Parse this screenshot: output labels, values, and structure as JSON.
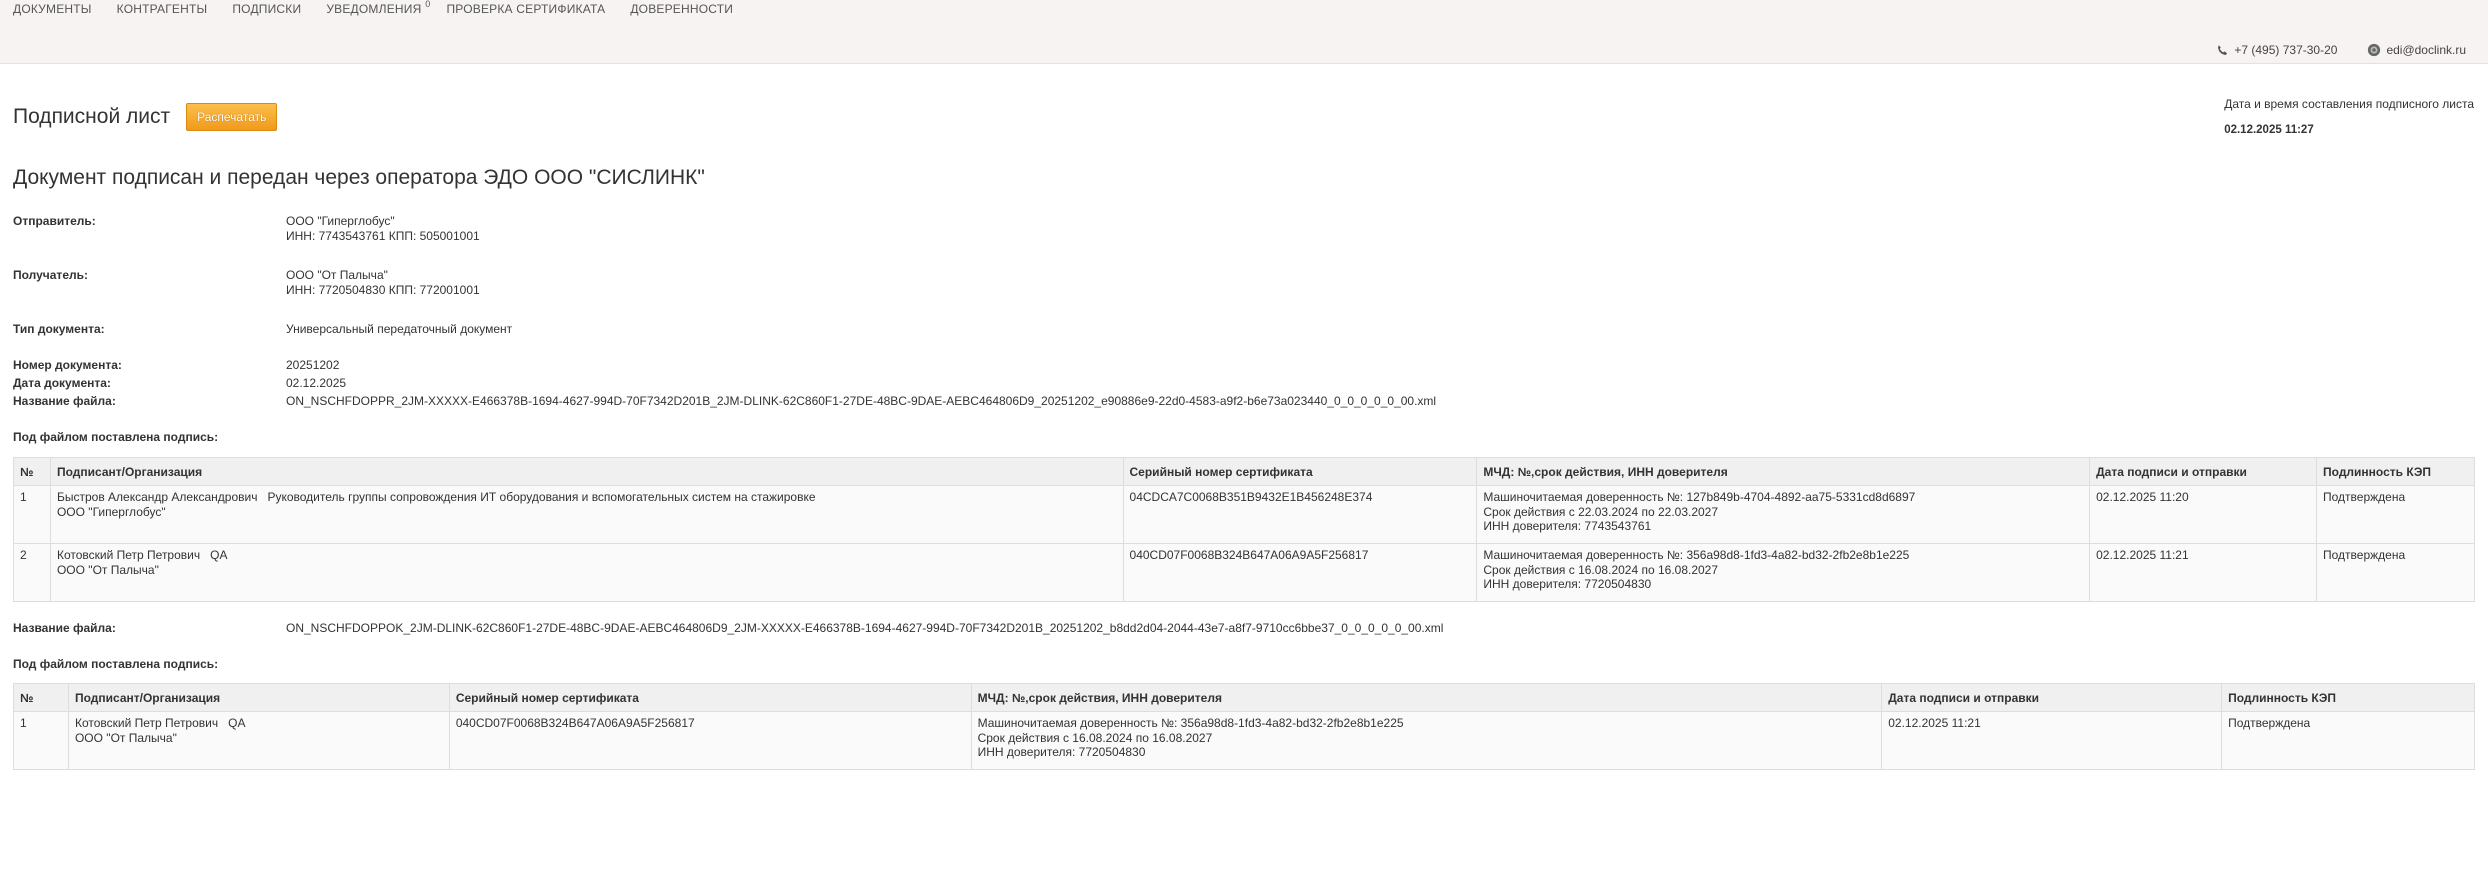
{
  "nav": {
    "items": [
      "ДОКУМЕНТЫ",
      "КОНТРАГЕНТЫ",
      "ПОДПИСКИ",
      "УВЕДОМЛЕНИЯ",
      "ПРОВЕРКА СЕРТИФИКАТА",
      "ДОВЕРЕННОСТИ"
    ],
    "notifications_count": "0"
  },
  "contacts": {
    "phone": "+7 (495) 737-30-20",
    "email": "edi@doclink.ru"
  },
  "page": {
    "title": "Подписной лист",
    "print_label": "Распечатать",
    "date_label": "Дата и время составления подписного листа",
    "date_value": "02.12.2025 11:27",
    "heading": "Документ подписан и передан через оператора ЭДО ООО \"СИСЛИНК\""
  },
  "document": {
    "sender_label": "Отправитель:",
    "sender_name": "ООО \"Гиперглобус\"",
    "sender_ids": "ИНН: 7743543761 КПП: 505001001",
    "recipient_label": "Получатель:",
    "recipient_name": "ООО \"От Палыча\"",
    "recipient_ids": "ИНН: 7720504830 КПП: 772001001",
    "type_label": "Тип документа:",
    "type_value": "Универсальный передаточный документ",
    "number_label": "Номер документа:",
    "number_value": "20251202",
    "date_label": "Дата документа:",
    "date_value": "02.12.2025",
    "filename_label": "Название файла:",
    "filename_value": "ON_NSCHFDOPPR_2JM-XXXXX-E466378B-1694-4627-994D-70F7342D201B_2JM-DLINK-62C860F1-27DE-48BC-9DAE-AEBC464806D9_20251202_e90886e9-22d0-4583-a9f2-b6e73a023440_0_0_0_0_0_00.xml"
  },
  "signatures1": {
    "title": "Под файлом поставлена подпись:",
    "headers": [
      "№",
      "Подписант/Организация",
      "Серийный номер сертификата",
      "МЧД: №,срок действия, ИНН доверителя",
      "Дата подписи и отправки",
      "Подлинность КЭП"
    ],
    "rows": [
      {
        "num": "1",
        "signer": "Быстров Александр Александрович   Руководитель группы сопровождения ИТ оборудования и вспомогательных систем на стажировке",
        "org": "ООО \"Гиперглобус\"",
        "serial": "04CDCA7C0068B351B9432E1B456248E374",
        "mchd_number": "Машиночитаемая доверенность №: 127b849b-4704-4892-aa75-5331cd8d6897",
        "mchd_validity": "Срок действия с 22.03.2024 по 22.03.2027",
        "mchd_inn": "ИНН доверителя: 7743543761",
        "date": "02.12.2025 11:20",
        "status": "Подтверждена"
      },
      {
        "num": "2",
        "signer": "Котовский Петр Петрович   QA",
        "org": "ООО \"От Палыча\"",
        "serial": "040CD07F0068B324B647A06A9A5F256817",
        "mchd_number": "Машиночитаемая доверенность №: 356a98d8-1fd3-4a82-bd32-2fb2e8b1e225",
        "mchd_validity": "Срок действия с 16.08.2024 по 16.08.2027",
        "mchd_inn": "ИНН доверителя: 7720504830",
        "date": "02.12.2025 11:21",
        "status": "Подтверждена"
      }
    ]
  },
  "file2": {
    "label": "Название файла:",
    "value": "ON_NSCHFDOPPOK_2JM-DLINK-62C860F1-27DE-48BC-9DAE-AEBC464806D9_2JM-XXXXX-E466378B-1694-4627-994D-70F7342D201B_20251202_b8dd2d04-2044-43e7-a8f7-9710cc6bbe37_0_0_0_0_0_00.xml"
  },
  "signatures2": {
    "title": "Под файлом поставлена подпись:",
    "headers": [
      "№",
      "Подписант/Организация",
      "Серийный номер сертификата",
      "МЧД: №,срок действия, ИНН доверителя",
      "Дата подписи и отправки",
      "Подлинность КЭП"
    ],
    "rows": [
      {
        "num": "1",
        "signer": "Котовский Петр Петрович   QA",
        "org": "ООО \"От Палыча\"",
        "serial": "040CD07F0068B324B647A06A9A5F256817",
        "mchd_number": "Машиночитаемая доверенность №: 356a98d8-1fd3-4a82-bd32-2fb2e8b1e225",
        "mchd_validity": "Срок действия с 16.08.2024 по 16.08.2027",
        "mchd_inn": "ИНН доверителя: 7720504830",
        "date": "02.12.2025 11:21",
        "status": "Подтверждена"
      }
    ]
  }
}
